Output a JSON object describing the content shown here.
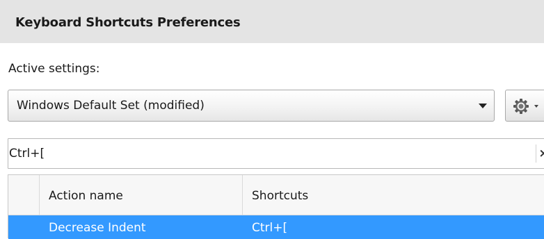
{
  "header": {
    "title": "Keyboard Shortcuts Preferences"
  },
  "settings": {
    "active_label": "Active settings:",
    "selected_set": "Windows Default Set (modified)"
  },
  "search": {
    "value": "Ctrl+[",
    "clear_glyph": "×"
  },
  "table": {
    "columns": [
      "",
      "Action name",
      "Shortcuts"
    ],
    "rows": [
      {
        "action": "Decrease Indent",
        "shortcut": "Ctrl+[",
        "selected": true
      }
    ]
  },
  "icons": {
    "gear": "gear-icon",
    "dropdown": "chevron-down-icon",
    "clear": "close-icon"
  },
  "colors": {
    "header_bg": "#e4e4e4",
    "selection": "#3399ff",
    "selection_text": "#ffffff"
  }
}
